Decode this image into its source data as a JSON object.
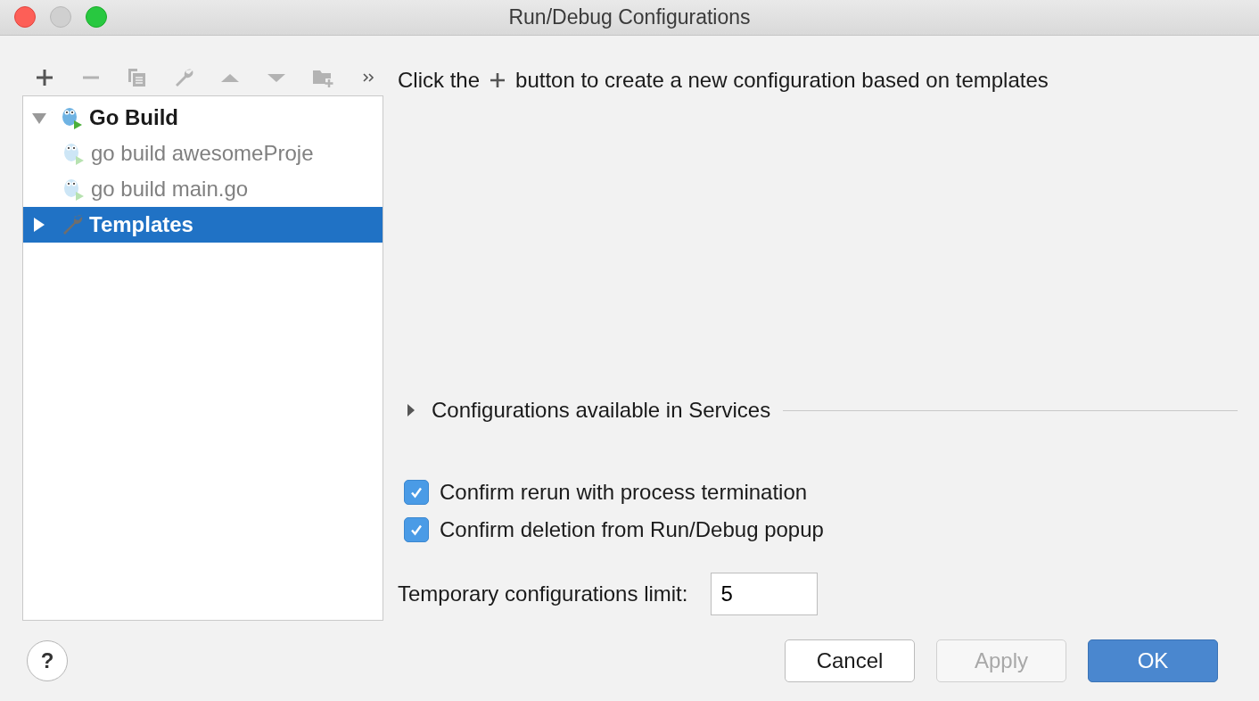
{
  "window": {
    "title": "Run/Debug Configurations"
  },
  "toolbar": [
    {
      "kind": "add",
      "disabled": false
    },
    {
      "kind": "remove",
      "disabled": true
    },
    {
      "kind": "copy",
      "disabled": true
    },
    {
      "kind": "edit",
      "disabled": true
    },
    {
      "kind": "up",
      "disabled": true
    },
    {
      "kind": "down",
      "disabled": true
    },
    {
      "kind": "folder",
      "disabled": true
    },
    {
      "kind": "more",
      "disabled": false
    }
  ],
  "tree": [
    {
      "label": "Go Build",
      "kind": "gopher",
      "expanded": true,
      "selected": false,
      "temporary": false,
      "children": [
        {
          "label": "go build awesomeProje",
          "kind": "gopher",
          "selected": false,
          "temporary": true
        },
        {
          "label": "go build main.go",
          "kind": "gopher",
          "selected": false,
          "temporary": true
        }
      ]
    },
    {
      "label": "Templates",
      "kind": "wrench",
      "expanded": false,
      "selected": true,
      "temporary": false
    }
  ],
  "hint": {
    "before": "Click the",
    "after": "button to create a new configuration based on templates"
  },
  "services": {
    "label": "Configurations available in Services",
    "expanded": false
  },
  "options": [
    {
      "label": "Confirm rerun with process termination",
      "checked": true
    },
    {
      "label": "Confirm deletion from Run/Debug popup",
      "checked": true
    }
  ],
  "limit": {
    "label": "Temporary configurations limit:",
    "value": "5"
  },
  "help": "?",
  "buttons": [
    {
      "label": "Cancel",
      "kind": "normal",
      "disabled": false
    },
    {
      "label": "Apply",
      "kind": "normal",
      "disabled": true
    },
    {
      "label": "OK",
      "kind": "default",
      "disabled": false
    }
  ]
}
